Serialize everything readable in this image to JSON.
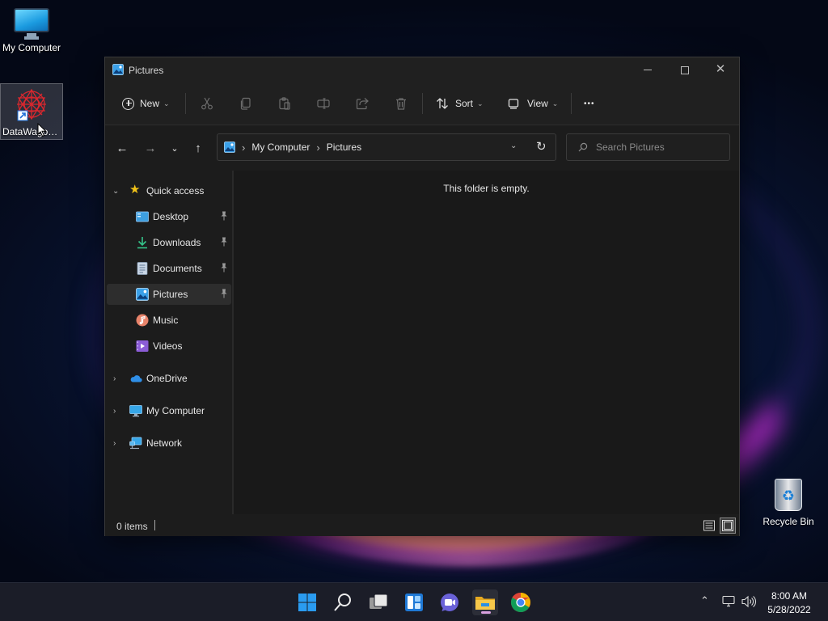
{
  "desktop": {
    "icons": [
      {
        "label": "My Computer"
      },
      {
        "label": "DataWagon..."
      },
      {
        "label": "Recycle Bin"
      }
    ]
  },
  "window": {
    "title": "Pictures",
    "toolbar": {
      "new_label": "New",
      "sort_label": "Sort",
      "view_label": "View",
      "more_label": "•••"
    },
    "address": {
      "crumbs": [
        "My Computer",
        "Pictures"
      ]
    },
    "search": {
      "placeholder": "Search Pictures"
    },
    "sidebar": {
      "quick_access": "Quick access",
      "items": [
        {
          "label": "Desktop",
          "pinned": true
        },
        {
          "label": "Downloads",
          "pinned": true
        },
        {
          "label": "Documents",
          "pinned": true
        },
        {
          "label": "Pictures",
          "pinned": true,
          "active": true
        },
        {
          "label": "Music"
        },
        {
          "label": "Videos"
        }
      ],
      "roots": [
        {
          "label": "OneDrive"
        },
        {
          "label": "My Computer"
        },
        {
          "label": "Network"
        }
      ]
    },
    "content": {
      "empty_message": "This folder is empty."
    },
    "status": {
      "items_count": "0 items"
    }
  },
  "taskbar": {
    "clock_time": "8:00 AM",
    "clock_date": "5/28/2022"
  },
  "colors": {
    "accent": "#0078d4",
    "window_bg": "#1c1c1c",
    "taskbar_bg": "#1b1d28"
  }
}
